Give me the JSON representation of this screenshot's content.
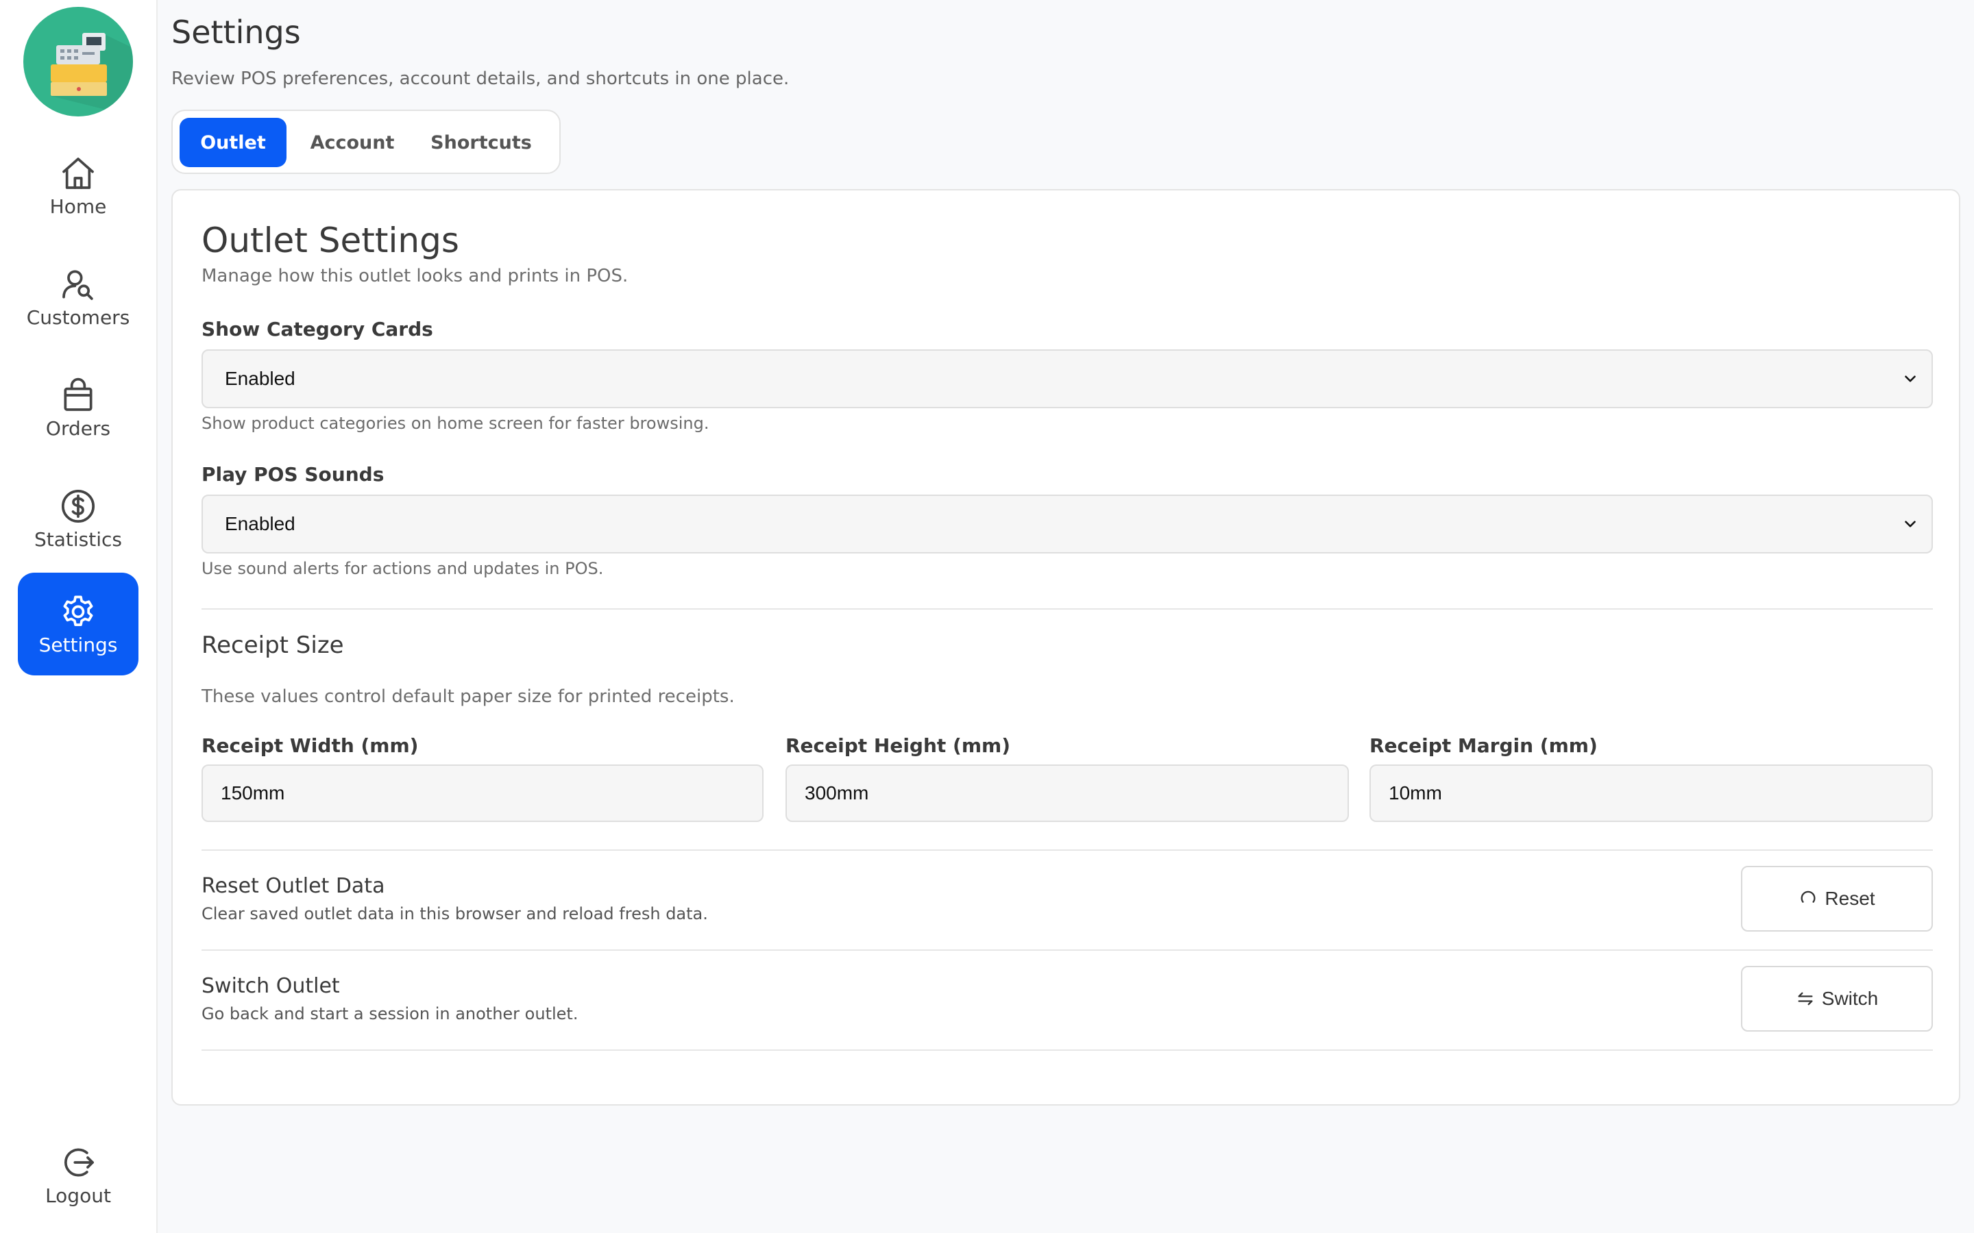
{
  "sidebar": {
    "logo_icon": "cash-register-icon",
    "items": [
      {
        "label": "Home",
        "icon": "home-icon"
      },
      {
        "label": "Customers",
        "icon": "customers-icon"
      },
      {
        "label": "Orders",
        "icon": "shopping-bag-icon"
      },
      {
        "label": "Statistics",
        "icon": "dollar-circle-icon"
      },
      {
        "label": "Settings",
        "icon": "gear-icon",
        "active": true
      }
    ],
    "logout": {
      "label": "Logout",
      "icon": "logout-icon"
    }
  },
  "header": {
    "title": "Settings",
    "subtitle": "Review POS preferences, account details, and shortcuts in one place."
  },
  "tabs": [
    {
      "label": "Outlet",
      "active": true
    },
    {
      "label": "Account"
    },
    {
      "label": "Shortcuts"
    }
  ],
  "outlet": {
    "title": "Outlet Settings",
    "subtitle": "Manage how this outlet looks and prints in POS.",
    "show_category_cards": {
      "label": "Show Category Cards",
      "value": "Enabled",
      "hint": "Show product categories on home screen for faster browsing."
    },
    "play_pos_sounds": {
      "label": "Play POS Sounds",
      "value": "Enabled",
      "hint": "Use sound alerts for actions and updates in POS."
    },
    "receipt": {
      "title": "Receipt Size",
      "description": "These values control default paper size for printed receipts.",
      "width": {
        "label": "Receipt Width (mm)",
        "value": "150mm"
      },
      "height": {
        "label": "Receipt Height (mm)",
        "value": "300mm"
      },
      "margin": {
        "label": "Receipt Margin (mm)",
        "value": "10mm"
      }
    },
    "reset": {
      "title": "Reset Outlet Data",
      "description": "Clear saved outlet data in this browser and reload fresh data.",
      "button": "Reset",
      "icon": "refresh-icon"
    },
    "switch": {
      "title": "Switch Outlet",
      "description": "Go back and start a session in another outlet.",
      "button": "Switch",
      "icon": "swap-arrows-icon"
    }
  },
  "colors": {
    "accent": "#0a5cf5",
    "logo_bg": "#33b58c",
    "page_bg": "#f8f9fb"
  }
}
